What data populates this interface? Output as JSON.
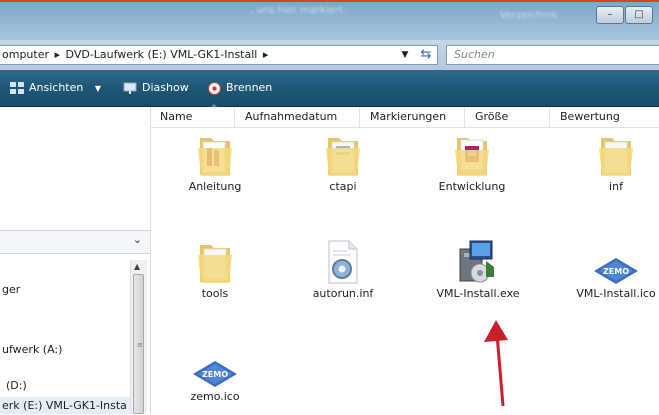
{
  "titlebar": {
    "blurred_text": ", uns hier markiert.",
    "blurred_text_right": "Verzeichnis"
  },
  "window_controls": {
    "minimize": "–",
    "maximize": "□"
  },
  "address": {
    "segments": [
      "omputer",
      "DVD-Laufwerk (E:) VML-GK1-Install"
    ],
    "separator": "▸",
    "search_placeholder": "Suchen"
  },
  "toolbar": {
    "views_label": "Ansichten",
    "slideshow_label": "Diashow",
    "burn_label": "Brennen"
  },
  "columns": [
    "Name",
    "Aufnahmedatum",
    "Markierungen",
    "Größe",
    "Bewertung"
  ],
  "navigation": {
    "items": [
      "ger",
      "ufwerk (A:)",
      "(D:)",
      "erk (E:) VML-GK1-Insta"
    ]
  },
  "files": [
    {
      "name": "Anleitung",
      "icon": "folder-icon"
    },
    {
      "name": "ctapi",
      "icon": "folder-icon"
    },
    {
      "name": "Entwicklung",
      "icon": "folder-icon"
    },
    {
      "name": "inf",
      "icon": "folder-icon"
    },
    {
      "name": "tools",
      "icon": "folder-icon"
    },
    {
      "name": "autorun.inf",
      "icon": "settings-file-icon"
    },
    {
      "name": "VML-Install.exe",
      "icon": "installer-icon"
    },
    {
      "name": "VML-Install.ico",
      "icon": "zemo-logo-icon"
    },
    {
      "name": "zemo.ico",
      "icon": "zemo-logo-icon"
    }
  ],
  "colors": {
    "toolbar": "#1e5775",
    "annotation_arrow": "#c9202b",
    "top_line": "#e53b2f"
  }
}
